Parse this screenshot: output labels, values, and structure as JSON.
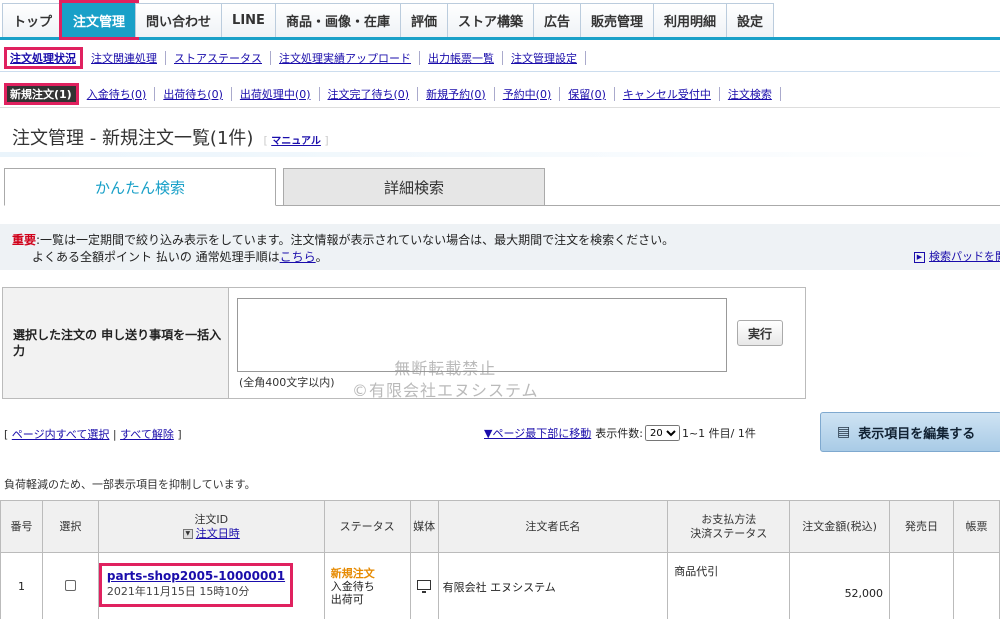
{
  "topnav": {
    "tabs": [
      "トップ",
      "注文管理",
      "問い合わせ",
      "LINE",
      "商品・画像・在庫",
      "評価",
      "ストア構築",
      "広告",
      "販売管理",
      "利用明細",
      "設定"
    ]
  },
  "subnav": {
    "items": [
      "注文処理状況",
      "注文関連処理",
      "ストアステータス",
      "注文処理実績アップロード",
      "出力帳票一覧",
      "注文管理設定"
    ]
  },
  "statusnav": {
    "items": [
      "新規注文(1)",
      "入金待ち(0)",
      "出荷待ち(0)",
      "出荷処理中(0)",
      "注文完了待ち(0)",
      "新規予約(0)",
      "予約中(0)",
      "保留(0)",
      "キャンセル受付中",
      "注文検索"
    ]
  },
  "page": {
    "title": "注文管理 - 新規注文一覧(1件)",
    "manual_link": "マニュアル"
  },
  "search_tabs": {
    "simple": "かんたん検索",
    "detail": "詳細検索"
  },
  "notice": {
    "label": "重要",
    "line1": ":一覧は一定期間で絞り込み表示をしています。注文情報が表示されていない場合は、最大期間で注文を検索ください。",
    "line2": "よくある全額ポイント 払いの 通常処理手順は",
    "line2_link": "こちら",
    "line2_tail": "。",
    "pad_link": "検索パッドを開"
  },
  "memo": {
    "label": "選択した注文の 申し送り事項を一括入力",
    "hint": "(全角400文字以内)",
    "run_button": "実行"
  },
  "watermark": {
    "line1": "無断転載禁止",
    "line2": "©有限会社エヌシステム"
  },
  "controls": {
    "select_all": "ページ内すべて選択",
    "clear_all": "すべて解除",
    "to_bottom": "▼ページ最下部に移動",
    "count_label": "表示件数:",
    "count_value": "20",
    "range": "1~1 件目/ 1件",
    "edit_button": "表示項目を編集する"
  },
  "load_note": "負荷軽減のため、一部表示項目を抑制しています。",
  "table": {
    "headers": {
      "no": "番号",
      "select": "選択",
      "order_id": "注文ID",
      "order_date": "注文日時",
      "status": "ステータス",
      "media": "媒体",
      "customer": "注文者氏名",
      "payment": "お支払方法",
      "payment_status": "決済ステータス",
      "amount": "注文金額(税込)",
      "ship_date": "発売日",
      "slip": "帳票"
    },
    "rows": [
      {
        "no": "1",
        "order_id": "parts-shop2005-10000001",
        "order_date": "2021年11月15日 15時10分",
        "status1": "新規注文",
        "status2": "入金待ち",
        "status3": "出荷可",
        "customer": "有限会社 エヌシステム",
        "payment": "商品代引",
        "amount": "52,000"
      }
    ]
  },
  "colors": {
    "accent": "#19a0c8",
    "highlight": "#e0215f",
    "important": "#d0021b",
    "new_order": "#e68a00"
  }
}
